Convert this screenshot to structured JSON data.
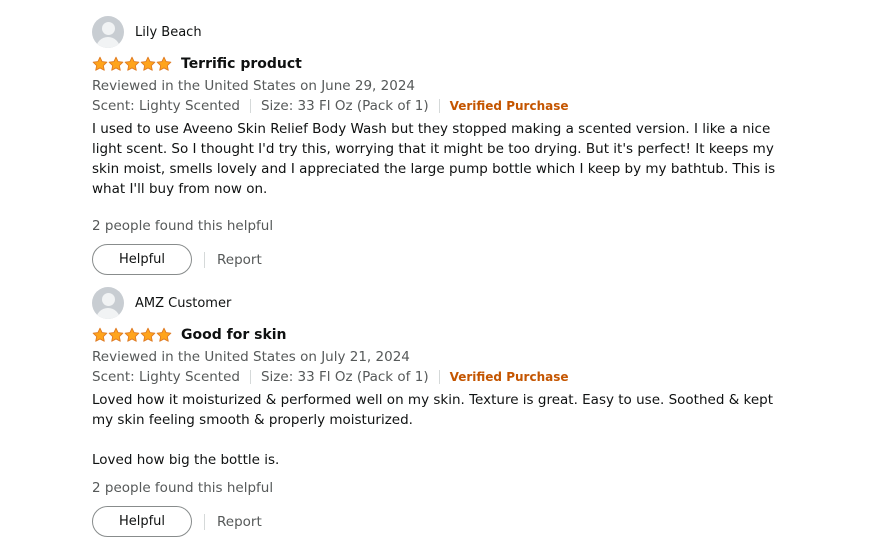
{
  "reviews": [
    {
      "profile_name": "Lily Beach",
      "rating": 5,
      "title": "Terrific product",
      "meta": "Reviewed in the United States on June 29, 2024",
      "scent": "Scent: Lighty Scented",
      "size": "Size: 33 Fl Oz (Pack of 1)",
      "verified": "Verified Purchase",
      "body": [
        "I used to use Aveeno Skin Relief Body Wash but they stopped making a scented version. I like a nice light scent. So I thought I'd try this, worrying that it might be too drying. But it's perfect! It keeps my skin moist, smells lovely and I appreciated the large pump bottle which I keep by my bathtub. This is what I'll buy from now on."
      ],
      "helpful_count": "2 people found this helpful",
      "helpful_label": "Helpful",
      "report_label": "Report"
    },
    {
      "profile_name": "AMZ Customer",
      "rating": 5,
      "title": "Good for skin",
      "meta": "Reviewed in the United States on July 21, 2024",
      "scent": "Scent: Lighty Scented",
      "size": "Size: 33 Fl Oz (Pack of 1)",
      "verified": "Verified Purchase",
      "body": [
        "Loved how it moisturized & performed well on my skin. Texture is great. Easy to use. Soothed & kept my skin feeling smooth & properly moisturized.",
        "Loved how big the bottle is."
      ],
      "helpful_count": "2 people found this helpful",
      "helpful_label": "Helpful",
      "report_label": "Report"
    }
  ],
  "colors": {
    "star": "#ffa41c",
    "star_stroke": "#de7921",
    "verified": "#c45500",
    "secondary_text": "#565959"
  },
  "icons": {
    "avatar": "default-profile-avatar-icon",
    "star": "star-icon"
  }
}
